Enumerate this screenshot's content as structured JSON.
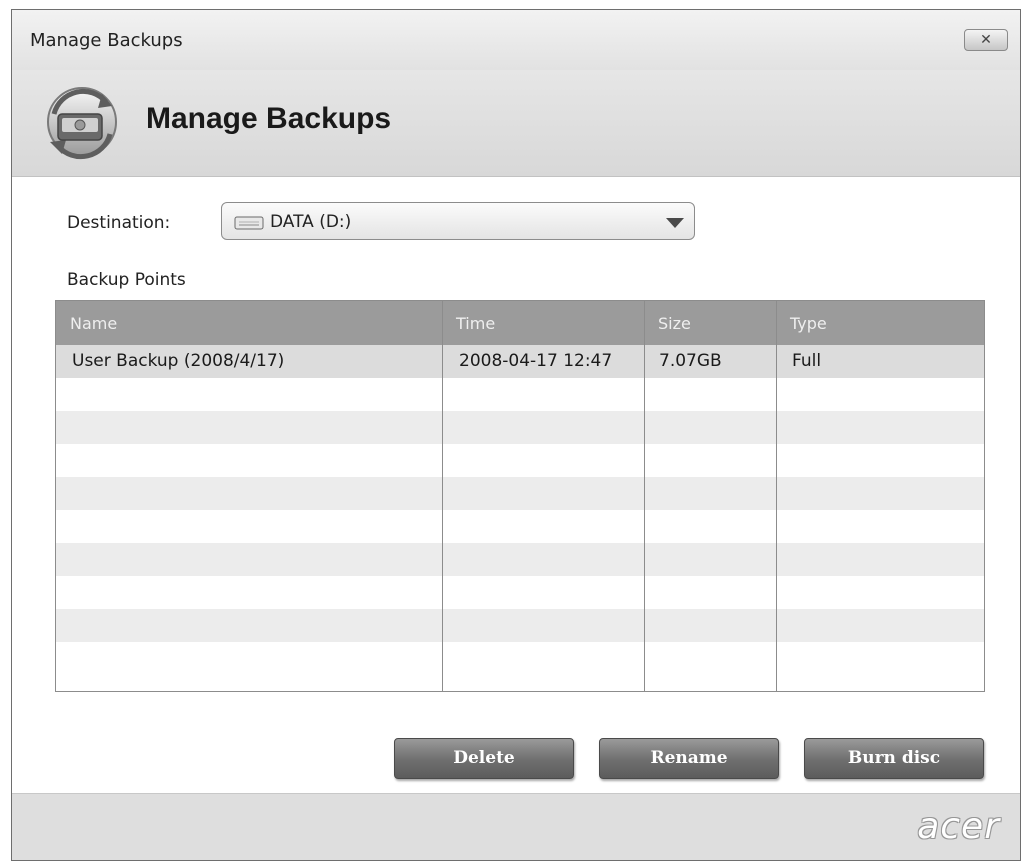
{
  "window": {
    "title": "Manage Backups",
    "close_glyph": "✕"
  },
  "header": {
    "title": "Manage Backups",
    "icon": "backup-drive-icon"
  },
  "destination": {
    "label": "Destination:",
    "value": "DATA (D:)",
    "icon": "drive-icon"
  },
  "backup_points": {
    "label": "Backup Points",
    "columns": [
      "Name",
      "Time",
      "Size",
      "Type"
    ],
    "rows": [
      {
        "name": "User Backup (2008/4/17)",
        "time": "2008-04-17 12:47",
        "size": "7.07GB",
        "type": "Full"
      }
    ]
  },
  "buttons": {
    "delete": "Delete",
    "rename": "Rename",
    "burn_disc": "Burn disc"
  },
  "footer": {
    "logo": "acer"
  }
}
